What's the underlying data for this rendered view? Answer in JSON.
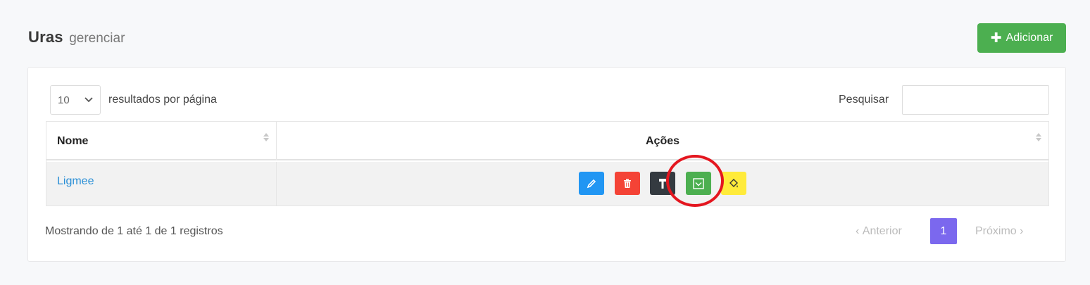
{
  "header": {
    "title": "Uras",
    "subtitle": "gerenciar",
    "add_button_label": "Adicionar",
    "add_icon": "plus-icon"
  },
  "table_controls": {
    "page_length_value": "10",
    "page_length_label": "resultados por página",
    "search_label": "Pesquisar",
    "search_value": ""
  },
  "table": {
    "columns": [
      "Nome",
      "Ações"
    ],
    "rows": [
      {
        "nome": "Ligmee",
        "actions": [
          {
            "icon": "pencil-icon",
            "color": "#2196f3"
          },
          {
            "icon": "trash-icon",
            "color": "#f44336"
          },
          {
            "icon": "hammer-icon",
            "color": "#343a40"
          },
          {
            "icon": "checkbox-icon",
            "color": "#4caf50",
            "highlighted": true
          },
          {
            "icon": "paint-bucket-icon",
            "color": "#ffeb3b"
          }
        ]
      }
    ]
  },
  "footer": {
    "info": "Mostrando de 1 até 1 de 1 registros",
    "prev_label": "Anterior",
    "current_page": "1",
    "next_label": "Próximo"
  },
  "colors": {
    "accent_green": "#4caf50",
    "pagination_active": "#7b68ee",
    "link_blue": "#2a8fd6",
    "annotation_red": "#e4161f"
  }
}
